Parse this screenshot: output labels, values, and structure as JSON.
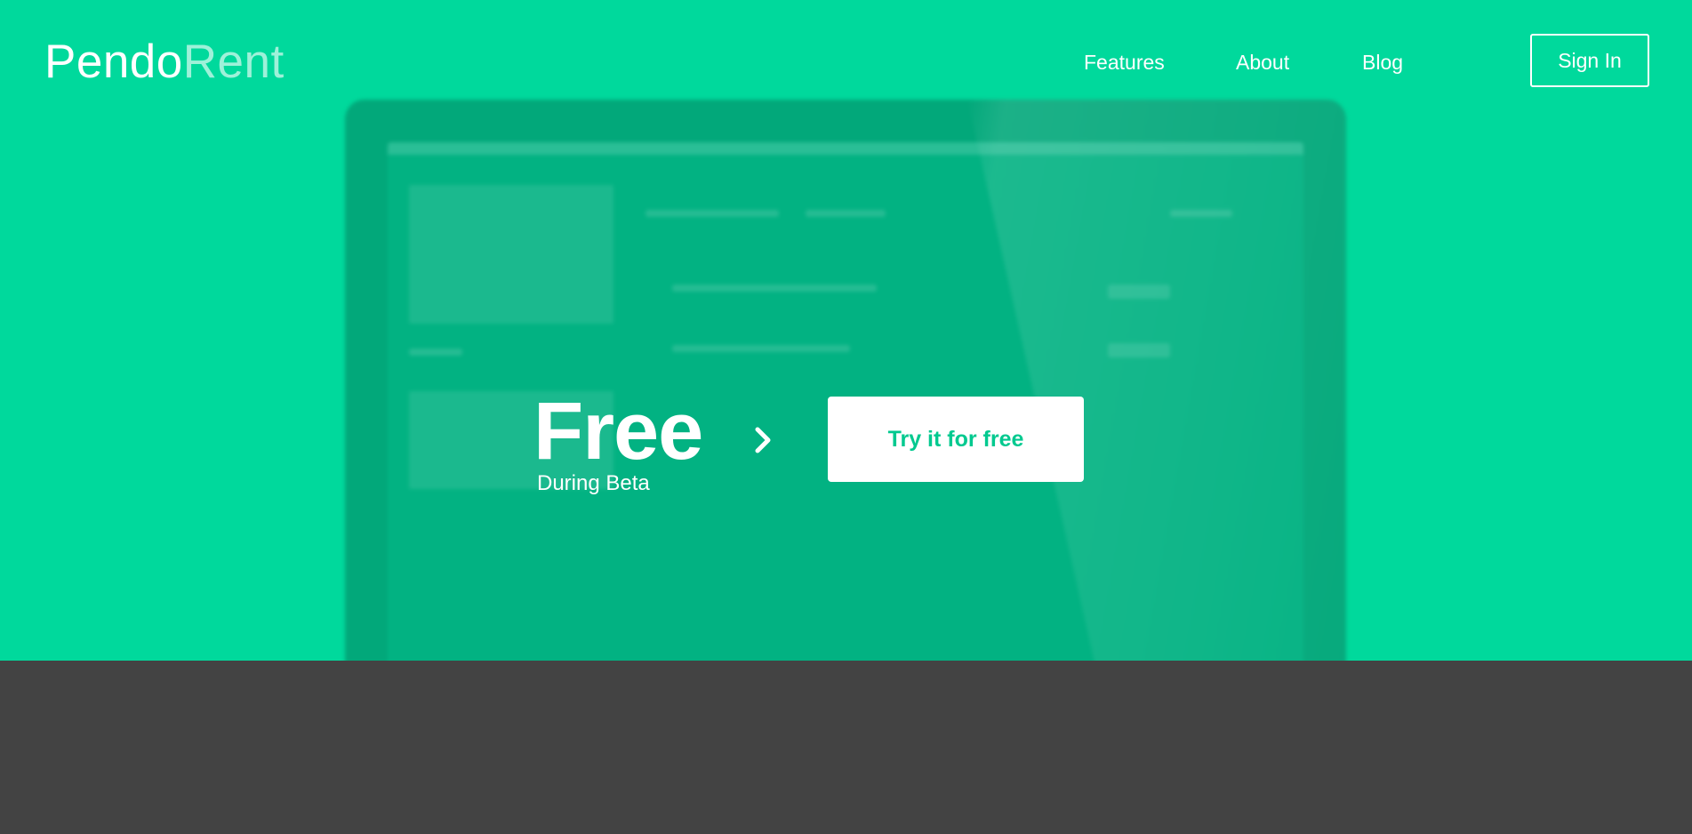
{
  "brand": {
    "name_part1": "Pendo",
    "name_part2": "Rent"
  },
  "nav": {
    "items": [
      {
        "label": "Features"
      },
      {
        "label": "About"
      },
      {
        "label": "Blog"
      }
    ],
    "sign_in": "Sign In"
  },
  "hero": {
    "headline": "Free",
    "subheadline": "During Beta",
    "cta_label": "Try it for free"
  },
  "colors": {
    "primary": "#00d99c",
    "footer": "#434343",
    "cta_text": "#00c98f"
  },
  "icons": {
    "arrow": "chevron-right-icon"
  }
}
